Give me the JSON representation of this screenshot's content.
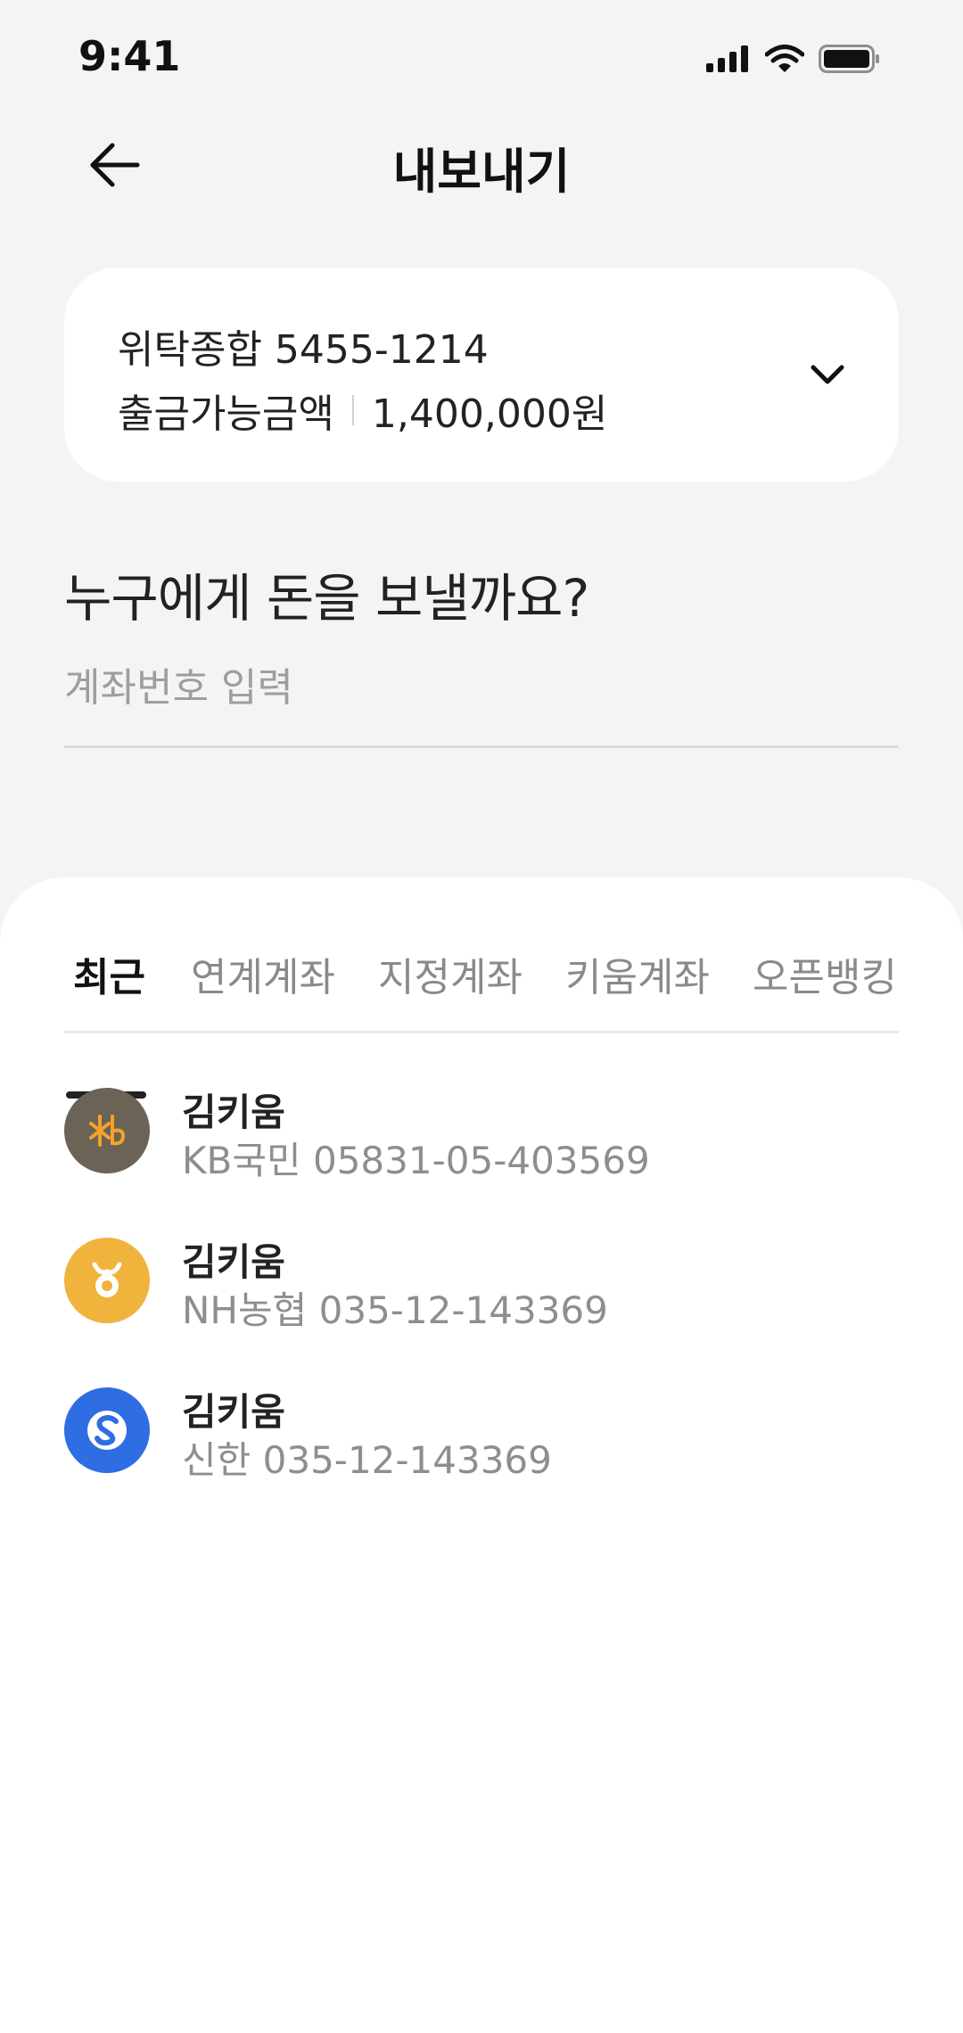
{
  "status_bar": {
    "time": "9:41"
  },
  "header": {
    "title": "내보내기",
    "back_icon": "arrow-left-icon"
  },
  "account": {
    "name": "위탁종합 5455-1214",
    "balance_label": "출금가능금액",
    "balance_value": "1,400,000원",
    "expand_icon": "chevron-down-icon"
  },
  "transfer": {
    "question": "누구에게 돈을 보낼까요?",
    "input_placeholder": "계좌번호 입력",
    "input_value": ""
  },
  "tabs": [
    {
      "label": "최근",
      "active": true
    },
    {
      "label": "연계계좌",
      "active": false
    },
    {
      "label": "지정계좌",
      "active": false
    },
    {
      "label": "키움계좌",
      "active": false
    },
    {
      "label": "오픈뱅킹",
      "active": false
    }
  ],
  "recent": [
    {
      "name": "김키움",
      "account": "KB국민 05831-05-403569",
      "bank_icon": "kb-bank-logo-icon",
      "color": "#6b6356"
    },
    {
      "name": "김키움",
      "account": "NH농협 035-12-143369",
      "bank_icon": "nh-bank-logo-icon",
      "color": "#f0b33c"
    },
    {
      "name": "김키움",
      "account": "신한 035-12-143369",
      "bank_icon": "shinhan-bank-logo-icon",
      "color": "#2f6de3"
    }
  ],
  "colors": {
    "background": "#f4f4f4",
    "card": "#ffffff",
    "primary_text": "#222222",
    "secondary_text": "#8e8e8e",
    "kb": "#6b6356",
    "kb_accent": "#f6a22a",
    "nh": "#f0b33c",
    "shinhan": "#2f6de3"
  }
}
